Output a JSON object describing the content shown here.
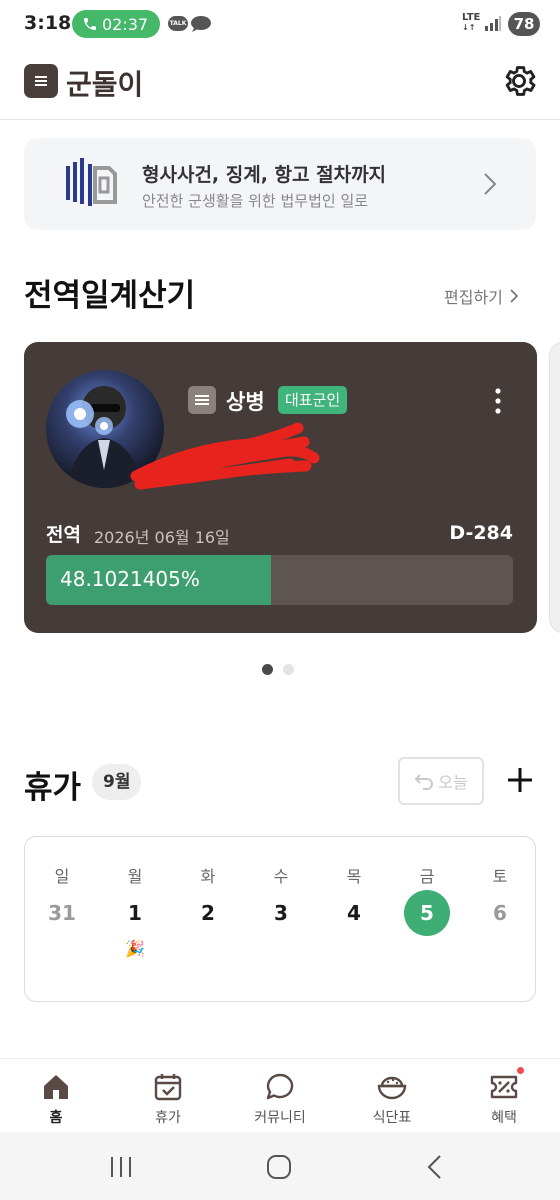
{
  "status_bar": {
    "time": "3:18",
    "call_timer": "02:37",
    "talk_label": "TALK",
    "network": "LTE",
    "battery": "78"
  },
  "app": {
    "title": "군돌이"
  },
  "banner": {
    "title": "형사사건, 징계, 항고 절차까지",
    "subtitle": "안전한 군생활을 위한 법무법인 일로"
  },
  "discharge_section": {
    "title": "전역일계산기",
    "edit_label": "편집하기"
  },
  "discharge_card": {
    "rank": "상병",
    "badge": "대표군인",
    "discharge_label": "전역",
    "discharge_date": "2026년 06월 16일",
    "dday": "D-284",
    "progress_text": "48.1021405%",
    "progress_value": 48.1021405
  },
  "pager": {
    "count": 2,
    "active": 0
  },
  "vacation": {
    "title": "휴가",
    "month": "9월",
    "today_label": "오늘",
    "weekdays": [
      "일",
      "월",
      "화",
      "수",
      "목",
      "금",
      "토"
    ],
    "days": [
      "31",
      "1",
      "2",
      "3",
      "4",
      "5",
      "6"
    ],
    "today_index": 5,
    "event_marker": "🎉"
  },
  "bottom_nav": {
    "items": [
      {
        "label": "홈",
        "icon": "home-icon",
        "active": true
      },
      {
        "label": "휴가",
        "icon": "calendar-check-icon",
        "active": false
      },
      {
        "label": "커뮤니티",
        "icon": "chat-bubble-icon",
        "active": false
      },
      {
        "label": "식단표",
        "icon": "rice-bowl-icon",
        "active": false
      },
      {
        "label": "혜택",
        "icon": "ticket-icon",
        "active": false
      }
    ]
  },
  "colors": {
    "accent": "#3fae74",
    "card_bg": "#453b38",
    "brand_dark": "#4a3e3a",
    "notification": "#f04b4b"
  }
}
